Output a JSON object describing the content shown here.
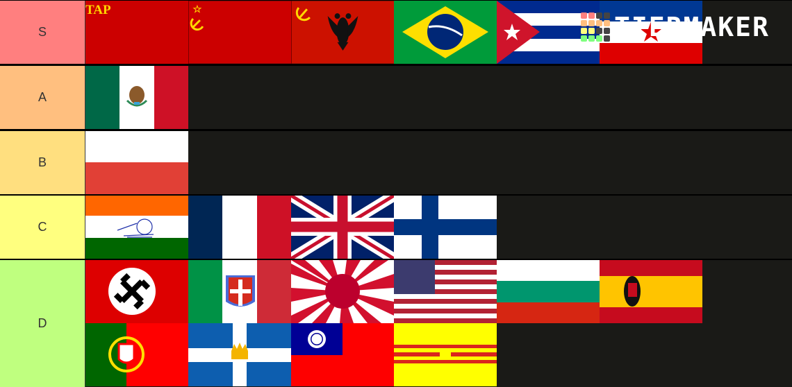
{
  "app": {
    "watermark": "TIERMAKER"
  },
  "tiers": [
    {
      "label": "S",
      "color": "#ff7f7f",
      "items": [
        "Soviet Union (Comintern)",
        "Soviet Union",
        "Communist Albania",
        "Brazil",
        "Cuba",
        "Yugoslavia"
      ]
    },
    {
      "label": "A",
      "color": "#ffbf7f",
      "items": [
        "Mexico"
      ]
    },
    {
      "label": "B",
      "color": "#ffdf7f",
      "items": [
        "Poland"
      ]
    },
    {
      "label": "C",
      "color": "#ffff7f",
      "items": [
        "India (Swaraj)",
        "France",
        "United Kingdom",
        "Finland"
      ]
    },
    {
      "label": "D",
      "color": "#bfff7f",
      "items": [
        "Nazi Germany",
        "Kingdom of Italy",
        "Imperial Japan",
        "United States",
        "Bulgaria",
        "Francoist Spain",
        "Portugal",
        "Kingdom of Greece",
        "Republic of China",
        "South Vietnam"
      ]
    }
  ],
  "flag_texts": {
    "comintern_banner": "TAP"
  },
  "watermark_colors": [
    "#ff7f7f",
    "#ff7f7f",
    "#444444",
    "#444444",
    "#ffbf7f",
    "#ffbf7f",
    "#ffbf7f",
    "#ffbf7f",
    "#ffff7f",
    "#ffff7f",
    "#444444",
    "#444444",
    "#7fff7f",
    "#7fff7f",
    "#7fff7f",
    "#444444"
  ]
}
